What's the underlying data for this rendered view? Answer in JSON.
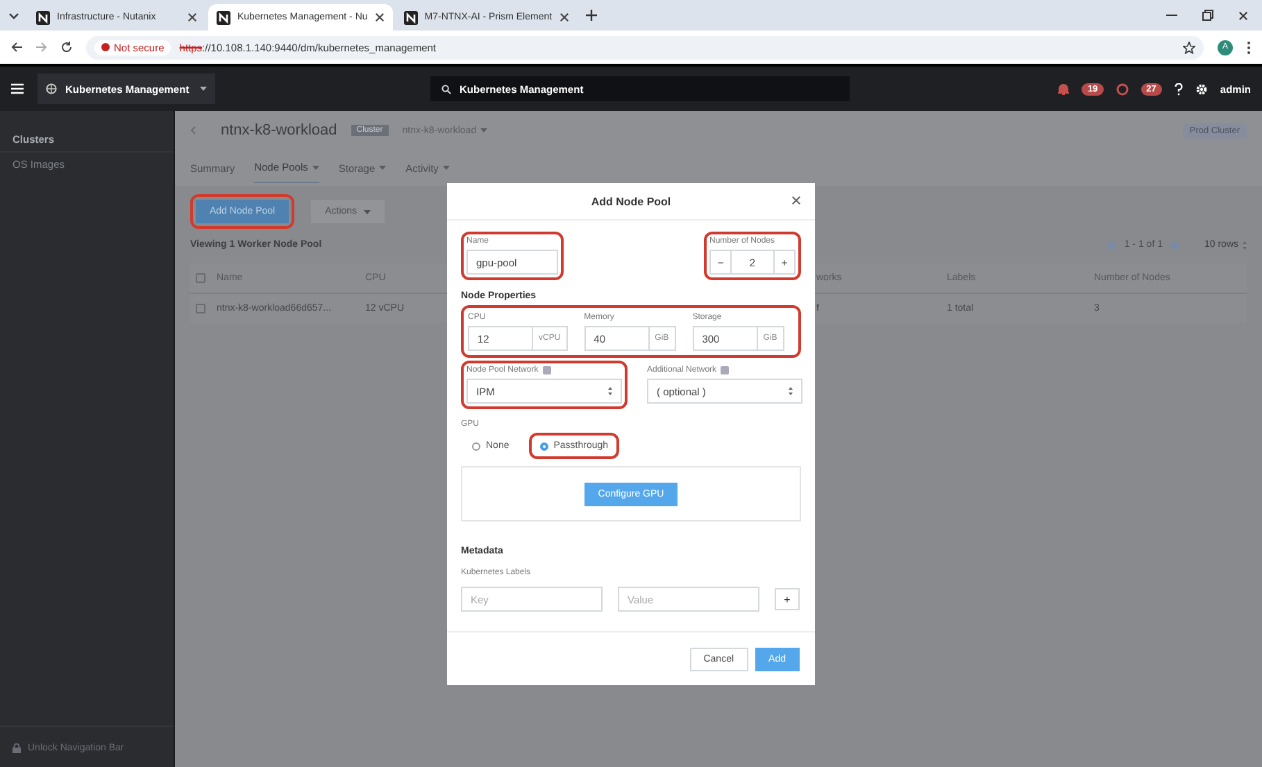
{
  "browser": {
    "tabs": [
      {
        "title": "Infrastructure - Nutanix",
        "selected": false
      },
      {
        "title": "Kubernetes Management - Nu",
        "selected": true
      },
      {
        "title": "M7-NTNX-AI - Prism Element",
        "selected": false
      }
    ],
    "security": "Not secure",
    "url_scheme": "https",
    "url_rest": "://10.108.1.140:9440/dm/kubernetes_management",
    "profile": "A"
  },
  "app_header": {
    "app_menu": "Kubernetes Management",
    "search": "Kubernetes Management",
    "alerts": "19",
    "tasks": "27",
    "user": "admin"
  },
  "sidebar": {
    "items": [
      {
        "label": "Clusters",
        "selected": true
      },
      {
        "label": "OS Images",
        "selected": false
      }
    ],
    "footer": "Unlock Navigation Bar"
  },
  "page": {
    "title": "ntnx-k8-workload",
    "tag": "Cluster",
    "tag_value": "ntnx-k8-workload",
    "badge": "Prod Cluster",
    "tabs": [
      {
        "label": "Summary",
        "selected": false,
        "dropdown": false
      },
      {
        "label": "Node Pools",
        "selected": true,
        "dropdown": true
      },
      {
        "label": "Storage",
        "selected": false,
        "dropdown": true
      },
      {
        "label": "Activity",
        "selected": false,
        "dropdown": true
      }
    ],
    "add_button": {
      "label": "Add Node Pool",
      "highlighted": true
    },
    "actions_button": "Actions",
    "viewing": "Viewing 1 Worker Node Pool",
    "pagination": "1 - 1 of 1",
    "rows_per_page": "10 rows",
    "table": {
      "columns": [
        "Name",
        "CPU",
        "",
        "works",
        "Labels",
        "Number of Nodes"
      ],
      "header_checked": false,
      "rows": [
        {
          "checked": false,
          "cells": [
            "ntnx-k8-workload66d657...",
            "12 vCPU",
            "",
            "f",
            "1 total",
            "3"
          ]
        }
      ]
    }
  },
  "modal": {
    "title": "Add Node Pool",
    "name": {
      "label": "Name",
      "value": "gpu-pool",
      "highlighted": true
    },
    "nodes": {
      "label": "Number of Nodes",
      "minus": "−",
      "value": "2",
      "plus": "+",
      "highlighted": true
    },
    "properties_title": "Node Properties",
    "properties_highlighted": true,
    "properties": [
      {
        "label": "CPU",
        "value": "12",
        "unit": "vCPU"
      },
      {
        "label": "Memory",
        "value": "40",
        "unit": "GiB"
      },
      {
        "label": "Storage",
        "value": "300",
        "unit": "GiB"
      }
    ],
    "networks": [
      {
        "label": "Node Pool Network",
        "value": "IPM",
        "highlighted": true
      },
      {
        "label": "Additional Network",
        "value": "( optional )",
        "highlighted": false
      }
    ],
    "gpu_label": "GPU",
    "gpu_options": [
      {
        "label": "None",
        "selected": false,
        "highlighted": false
      },
      {
        "label": "Passthrough",
        "selected": true,
        "highlighted": true
      }
    ],
    "configure_button": "Configure GPU",
    "metadata_title": "Metadata",
    "labels_title": "Kubernetes Labels",
    "key_placeholder": "Key",
    "value_placeholder": "Value",
    "add_label": "+",
    "cancel": "Cancel",
    "add": "Add"
  }
}
